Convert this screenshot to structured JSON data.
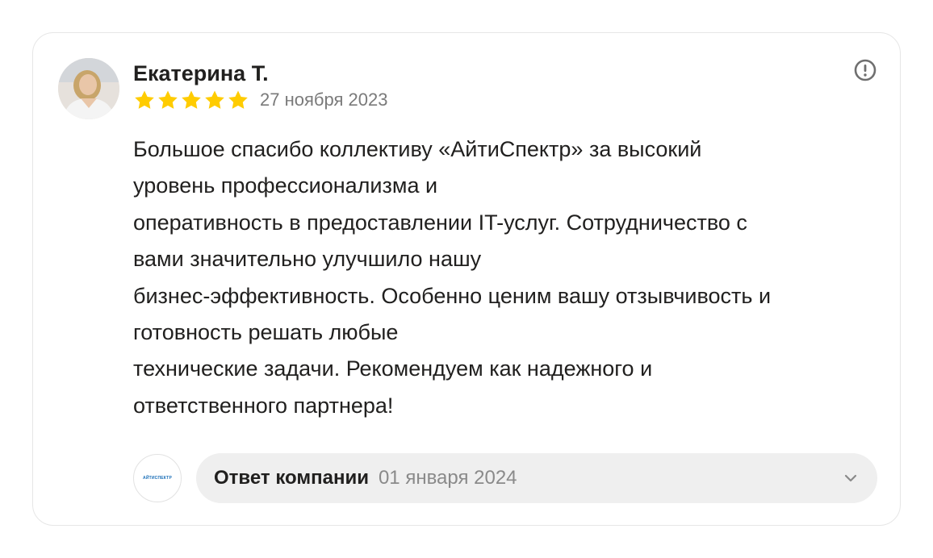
{
  "review": {
    "author_name": "Екатерина Т.",
    "rating": 5,
    "rating_max": 5,
    "date": "27 ноября 2023",
    "text_lines": [
      "Большое спасибо коллективу «АйтиСпектр» за высокий",
      "уровень профессионализма и",
      "оперативность в предоставлении IT-услуг. Сотрудничество с",
      "вами значительно улучшило нашу",
      "бизнес-эффективность. Особенно ценим вашу отзывчивость и",
      "готовность решать любые",
      "технические задачи. Рекомендуем как надежного и",
      "ответственного партнера!"
    ]
  },
  "company_reply": {
    "logo_text": "АЙТИСПЕКТР",
    "label": "Ответ компании",
    "date": "01 января 2024"
  },
  "icons": {
    "complaint": "exclamation-circle-icon",
    "star": "star-icon",
    "expand": "chevron-down-icon",
    "avatar": "user-photo"
  },
  "colors": {
    "star": "#ffcc00",
    "reply_background": "#efefef",
    "muted_text": "#7a7a7a"
  }
}
